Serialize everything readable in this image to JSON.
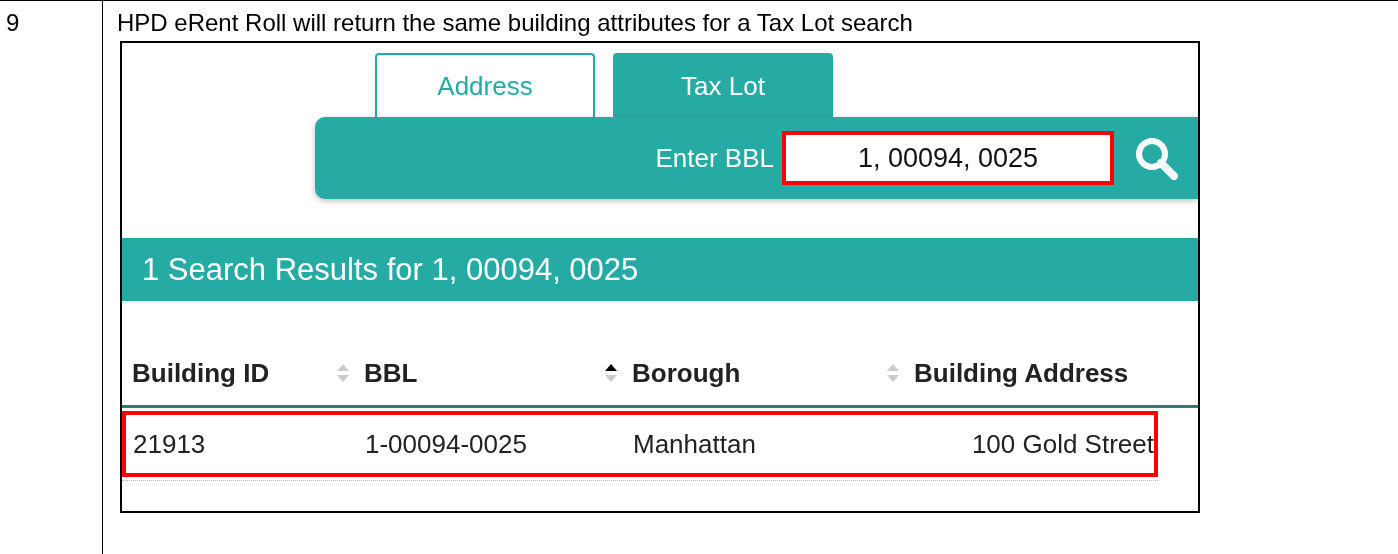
{
  "step": {
    "number": "9",
    "description": "HPD eRent Roll will return the same building attributes for a Tax Lot search"
  },
  "tabs": [
    {
      "label": "Address",
      "selected": false
    },
    {
      "label": "Tax Lot",
      "selected": true
    }
  ],
  "search": {
    "label": "Enter BBL",
    "value": "1, 00094, 0025",
    "highlighted": true
  },
  "results_title": "1 Search Results for 1, 00094, 0025",
  "table": {
    "columns": [
      {
        "label": "Building ID",
        "sorted_ascending": false
      },
      {
        "label": "BBL",
        "sorted_ascending": true
      },
      {
        "label": "Borough",
        "sorted_ascending": false
      },
      {
        "label": "Building Address"
      }
    ],
    "rows": [
      {
        "cells": [
          "21913",
          "1-00094-0025",
          "Manhattan",
          "100 Gold Street"
        ],
        "highlighted": true
      }
    ]
  }
}
